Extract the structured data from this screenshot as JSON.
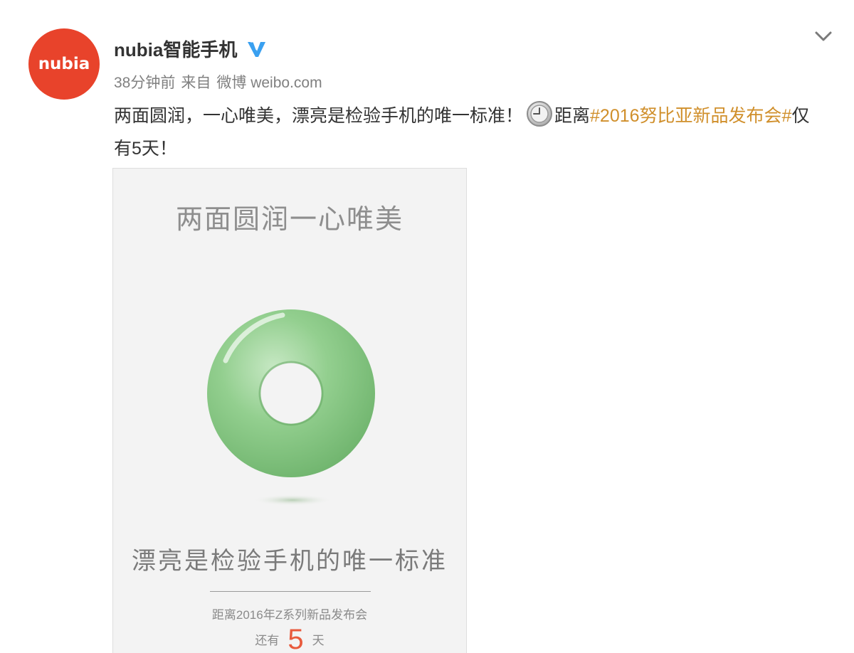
{
  "user": {
    "avatar_text": "nubia",
    "name": "nubia智能手机"
  },
  "meta": {
    "time": "38分钟前",
    "from_label": "来自",
    "source": "微博 weibo.com"
  },
  "post": {
    "text_main": "两面圆润，一心唯美，漂亮是检验手机的唯一标准！",
    "text_before_topic": "距离",
    "topic": "#2016努比亚新品发布会#",
    "text_after_topic": "仅有5天！"
  },
  "image": {
    "title": "两面圆润一心唯美",
    "subtitle": "漂亮是检验手机的唯一标准",
    "event": "距离2016年Z系列新品发布会",
    "countdown_prefix": "还有",
    "countdown_number": "5",
    "countdown_suffix": "天"
  },
  "icons": {
    "verified": "verified-v-icon",
    "chevron": "chevron-down-icon",
    "clock": "clock-emoji-icon"
  },
  "colors": {
    "brand": "#e8432b",
    "topic": "#d08f2b",
    "verified": "#3aa0f0",
    "donut": "#8cc98a"
  }
}
